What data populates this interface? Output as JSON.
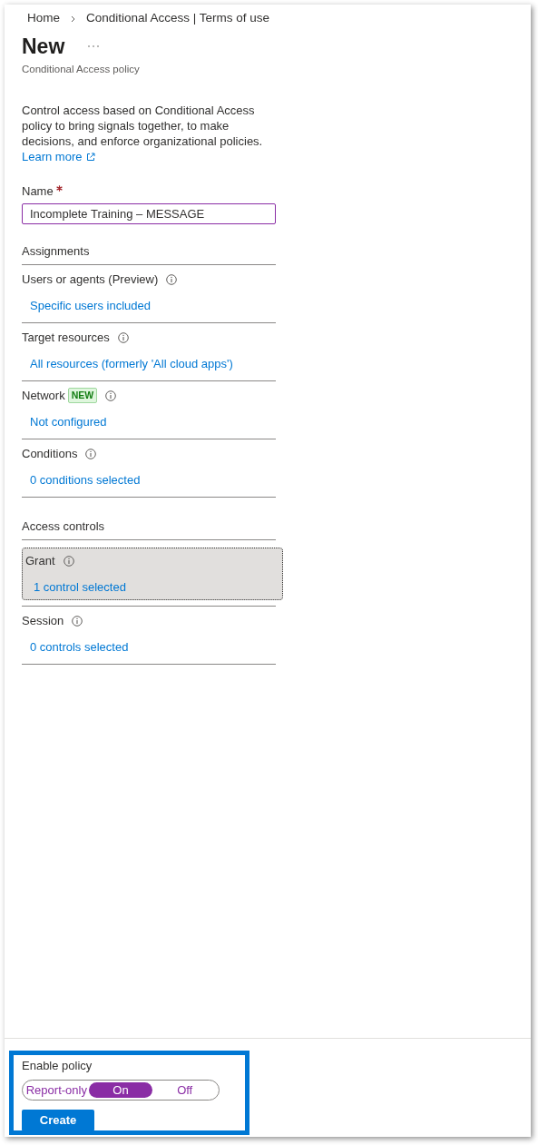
{
  "breadcrumb": [
    "Home",
    "Conditional Access | Terms of use"
  ],
  "header": {
    "title": "New",
    "subtitle": "Conditional Access policy"
  },
  "description": "Control access based on Conditional Access policy to bring signals together, to make decisions, and enforce organizational policies.",
  "learn_more": "Learn more",
  "name_field": {
    "label": "Name",
    "required": true,
    "value": "Incomplete Training – MESSAGE"
  },
  "sections": [
    {
      "heading": "Assignments",
      "items": [
        {
          "label": "Users or agents (Preview)",
          "value": "Specific users included",
          "selected": false
        },
        {
          "label": "Target resources",
          "value": "All resources (formerly 'All cloud apps')",
          "selected": false
        },
        {
          "label": "Network",
          "badge": "NEW",
          "value": "Not configured",
          "selected": false
        },
        {
          "label": "Conditions",
          "value": "0 conditions selected",
          "selected": false
        }
      ]
    },
    {
      "heading": "Access controls",
      "items": [
        {
          "label": "Grant",
          "value": "1 control selected",
          "selected": true
        },
        {
          "label": "Session",
          "value": "0 controls selected",
          "selected": false
        }
      ]
    }
  ],
  "footer": {
    "highlighted": true,
    "label": "Enable policy",
    "options": [
      {
        "label": "Report-only",
        "selected": false
      },
      {
        "label": "On",
        "selected": true
      },
      {
        "label": "Off",
        "selected": false
      }
    ],
    "create_button": "Create"
  }
}
